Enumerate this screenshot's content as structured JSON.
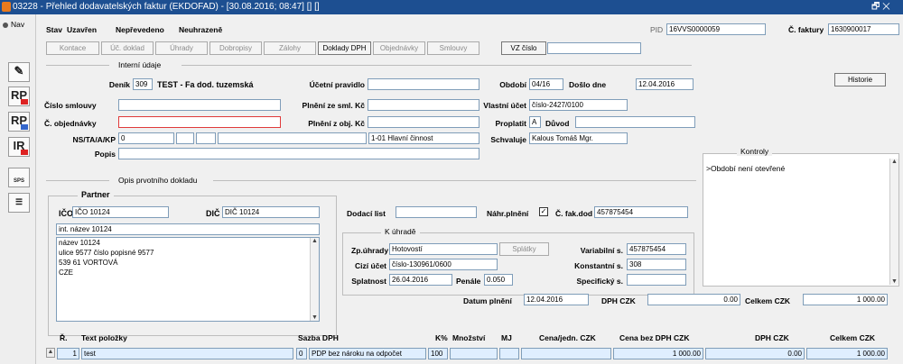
{
  "window": {
    "title": "03228 - Přehled dodavatelských faktur (EKDOFAD) - [30.08.2016; 08:47] [] []",
    "controls": "🗗 ✕"
  },
  "nav": {
    "label": "Nav",
    "buttons": [
      "",
      "RP",
      "RP",
      "IR",
      "SPS",
      ""
    ]
  },
  "status": {
    "stav_label": "Stav",
    "stav": "Uzavřen",
    "prevedeno": "Nepřevedeno",
    "schvaleno": "Neuhrazeně"
  },
  "pid": {
    "label": "PID",
    "value": "16VVS0000059"
  },
  "faktura": {
    "label": "Č. faktury",
    "value": "1630900017"
  },
  "toolbar": [
    "Kontace",
    "Úč. doklad",
    "Úhrady",
    "Dobropisy",
    "Zálohy",
    "Doklady DPH",
    "Objednávky",
    "Smlouvy",
    "VZ číslo"
  ],
  "interni": {
    "title": "Interní údaje",
    "historie": "Historie",
    "denik_label": "Deník",
    "denik_code": "309",
    "denik_name": "TEST - Fa dod. tuzemská",
    "ucetni_pravidlo_label": "Účetní pravidlo",
    "ucetni_pravidlo": "",
    "obdobi_label": "Období",
    "obdobi": "04/16",
    "doslo_label": "Došlo dne",
    "doslo": "12.04.2016",
    "cislo_smlouvy_label": "Číslo smlouvy",
    "cislo_smlouvy": "",
    "plneni_sml_label": "Plnění ze sml. Kč",
    "plneni_sml": "",
    "vlastni_ucet_label": "Vlastní účet",
    "vlastni_ucet": "číslo-2427/0100",
    "c_objednavky_label": "Č. objednávky",
    "c_objednavky": "",
    "plneni_obj_label": "Plnění z obj. Kč",
    "plneni_obj": "",
    "proplatit_label": "Proplatit",
    "proplatit": "A",
    "duvod_label": "Důvod",
    "duvod": "",
    "ns_label": "NS/TA/A/KP",
    "ns": "0",
    "ns_kp": "1-01 Hlavní činnost",
    "schvaluje_label": "Schvaluje",
    "schvaluje": "Kalous Tomáš Mgr.",
    "popis_label": "Popis",
    "popis": ""
  },
  "kontroly": {
    "title": "Kontroly",
    "text": ">Období není otevřené"
  },
  "opis": {
    "title": "Opis prvotního dokladu"
  },
  "partner": {
    "title": "Partner",
    "ico_label": "IČO",
    "ico": "IČO 10124",
    "dic_label": "DIČ",
    "dic": "DIČ 10124",
    "int_nazev": "int. název 10124",
    "address": [
      "název 10124",
      "ulice 9577 číslo popisné 9577",
      "539 61 VORTOVÁ",
      "CZE"
    ]
  },
  "doklad": {
    "dodaci_label": "Dodací list",
    "dodaci": "",
    "nahr_label": "Náhr.plnění",
    "nahr_check": "✓",
    "fak_dod_label": "Č. fak.dod",
    "fak_dod": "457875454"
  },
  "uhrade": {
    "title": "K úhradě",
    "zp_label": "Zp.úhrady",
    "zp": "Hotovostí",
    "splatky": "Splátky",
    "var_label": "Variabilní s.",
    "var": "457875454",
    "cizi_label": "Cizí účet",
    "cizi": "číslo-130961/0600",
    "konst_label": "Konstantní s.",
    "konst": "308",
    "splatnost_label": "Splatnost",
    "splatnost": "26.04.2016",
    "penale_label": "Penále",
    "penale": "0.050",
    "spec_label": "Specifický s.",
    "spec": ""
  },
  "totals": {
    "datum_label": "Datum plnění",
    "datum": "12.04.2016",
    "dph_label": "DPH CZK",
    "dph": "0.00",
    "celkem_label": "Celkem CZK",
    "celkem": "1 000.00"
  },
  "table": {
    "headers": [
      "Ř.",
      "Text položky",
      "Sazba DPH",
      "K%",
      "Množství",
      "MJ",
      "Cena/jedn. CZK",
      "Cena bez DPH CZK",
      "DPH CZK",
      "Celkem CZK"
    ],
    "row": {
      "r": "1",
      "text": "test",
      "sazba_code": "0",
      "sazba": "PDP bez nároku na odpočet",
      "k": "100",
      "mnozstvi": "",
      "mj": "",
      "cena": "",
      "bez_dph": "1 000.00",
      "dph": "0.00",
      "celkem": "1 000.00"
    }
  }
}
